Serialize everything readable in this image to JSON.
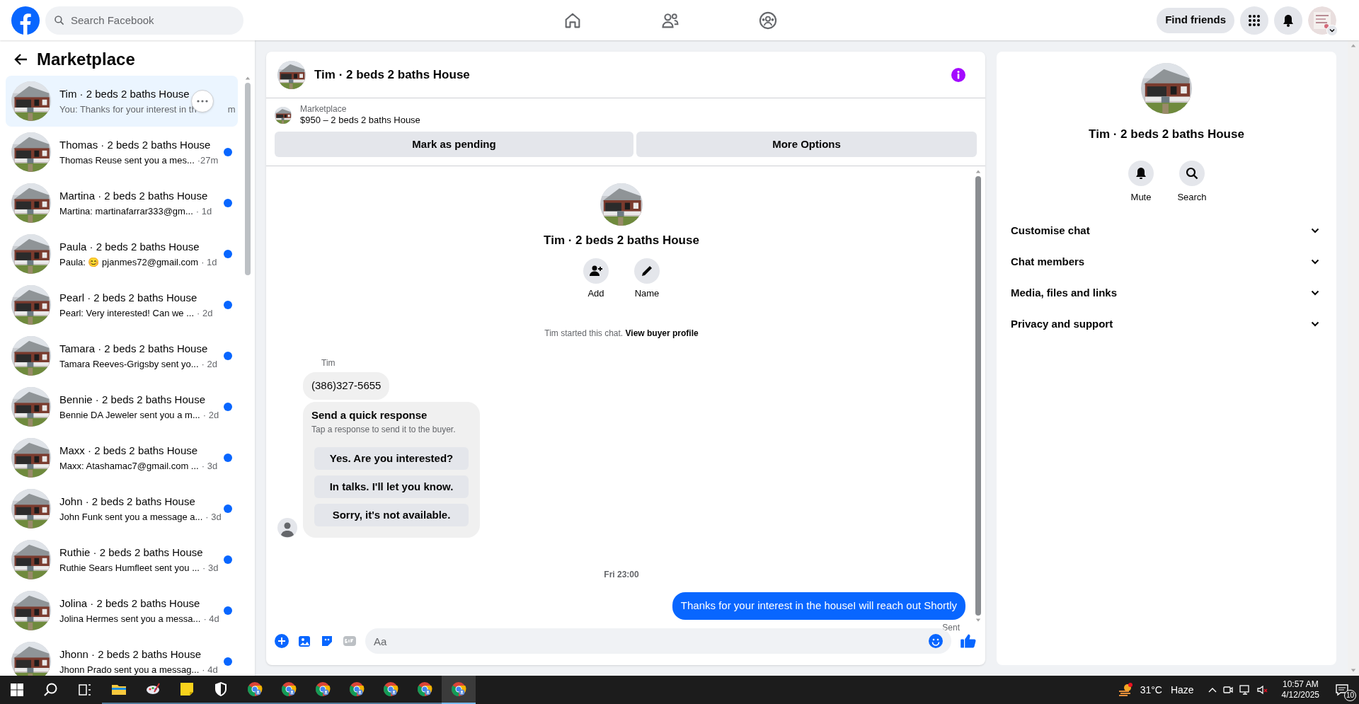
{
  "topbar": {
    "search_placeholder": "Search Facebook",
    "nav": [
      {
        "kind": "home",
        "selected": false
      },
      {
        "kind": "friends",
        "selected": false
      },
      {
        "kind": "groups",
        "selected": false
      }
    ],
    "find_friends": "Find friends"
  },
  "sidebar": {
    "title": "Marketplace",
    "conversations": [
      {
        "title": "Tim · 2 beds 2 baths House",
        "preview": "You: Thanks for your interest in th",
        "time": "m",
        "selected": true,
        "unread": false
      },
      {
        "title": "Thomas · 2 beds 2 baths House",
        "preview": "Thomas Reuse sent you a mes...",
        "time": "·27m",
        "selected": false,
        "unread": true
      },
      {
        "title": "Martina · 2 beds 2 baths House",
        "preview": "Martina: martinafarrar333@gm...",
        "time": "· 1d",
        "selected": false,
        "unread": true
      },
      {
        "title": "Paula · 2 beds 2 baths House",
        "preview": "Paula: 😊 pjanmes72@gmail.com",
        "time": "· 1d",
        "selected": false,
        "unread": true
      },
      {
        "title": "Pearl · 2 beds 2 baths House",
        "preview": "Pearl: Very interested! Can we ...",
        "time": "· 2d",
        "selected": false,
        "unread": true
      },
      {
        "title": "Tamara · 2 beds 2 baths House",
        "preview": "Tamara Reeves-Grigsby sent yo...",
        "time": "· 2d",
        "selected": false,
        "unread": true
      },
      {
        "title": "Bennie · 2 beds 2 baths House",
        "preview": "Bennie DA Jeweler sent you a m...",
        "time": "· 2d",
        "selected": false,
        "unread": true
      },
      {
        "title": "Maxx · 2 beds 2 baths House",
        "preview": "Maxx: Atashamac7@gmail.com ...",
        "time": "· 3d",
        "selected": false,
        "unread": true
      },
      {
        "title": "John · 2 beds 2 baths House",
        "preview": "John Funk sent you a message a...",
        "time": "· 3d",
        "selected": false,
        "unread": true
      },
      {
        "title": "Ruthie · 2 beds 2 baths House",
        "preview": "Ruthie Sears Humfleet sent you ...",
        "time": "· 3d",
        "selected": false,
        "unread": true
      },
      {
        "title": "Jolina · 2 beds 2 baths House",
        "preview": "Jolina Hermes sent you a messa...",
        "time": "· 4d",
        "selected": false,
        "unread": true
      },
      {
        "title": "Jhonn · 2 beds 2 baths House",
        "preview": "Jhonn Prado sent you a messag...",
        "time": "· 4d",
        "selected": false,
        "unread": true
      }
    ]
  },
  "chat": {
    "title": "Tim · 2 beds 2 baths House",
    "listing": {
      "label": "Marketplace",
      "detail": "$950 – 2 beds 2 baths House"
    },
    "actions": [
      "Mark as pending",
      "More Options"
    ],
    "profile": {
      "name": "Tim · 2 beds 2 baths House",
      "buttons": [
        {
          "kind": "add",
          "label": "Add"
        },
        {
          "kind": "name",
          "label": "Name"
        }
      ]
    },
    "system_note": {
      "text": "Tim started this chat.",
      "link": "View buyer profile"
    },
    "incoming": {
      "sender": "Tim",
      "text": "(386)327-5655"
    },
    "quick_response": {
      "title": "Send a quick response",
      "subtitle": "Tap a response to send it to the buyer.",
      "options": [
        "Yes. Are you interested?",
        "In talks. I'll let you know.",
        "Sorry, it's not available."
      ]
    },
    "timestamp": "Fri 23:00",
    "outgoing": {
      "text": "Thanks for your interest in the houseI will reach out Shortly",
      "status": "Sent"
    },
    "composer": {
      "placeholder": "Aa"
    }
  },
  "details": {
    "name": "Tim · 2 beds 2 baths House",
    "actions": [
      {
        "kind": "mute",
        "label": "Mute"
      },
      {
        "kind": "search",
        "label": "Search"
      }
    ],
    "sections": [
      {
        "label": "Customise chat",
        "expanded": false
      },
      {
        "label": "Chat members",
        "expanded": false
      },
      {
        "label": "Media, files and links",
        "expanded": false
      },
      {
        "label": "Privacy and support",
        "expanded": false
      }
    ]
  },
  "taskbar": {
    "apps": [
      {
        "kind": "explorer",
        "selected": false
      },
      {
        "kind": "paint",
        "selected": false
      },
      {
        "kind": "notes",
        "selected": false
      },
      {
        "kind": "shield",
        "selected": false
      },
      {
        "kind": "chrome",
        "selected": false
      },
      {
        "kind": "chrome",
        "selected": false
      },
      {
        "kind": "chrome",
        "selected": false
      },
      {
        "kind": "chrome",
        "selected": false
      },
      {
        "kind": "chrome",
        "selected": false
      },
      {
        "kind": "chrome",
        "selected": false
      },
      {
        "kind": "chrome",
        "selected": true
      }
    ],
    "weather": {
      "temp": "31°C",
      "condition": "Haze"
    },
    "clock": {
      "time": "10:57 AM",
      "date": "4/12/2025"
    },
    "notifications": "10"
  }
}
